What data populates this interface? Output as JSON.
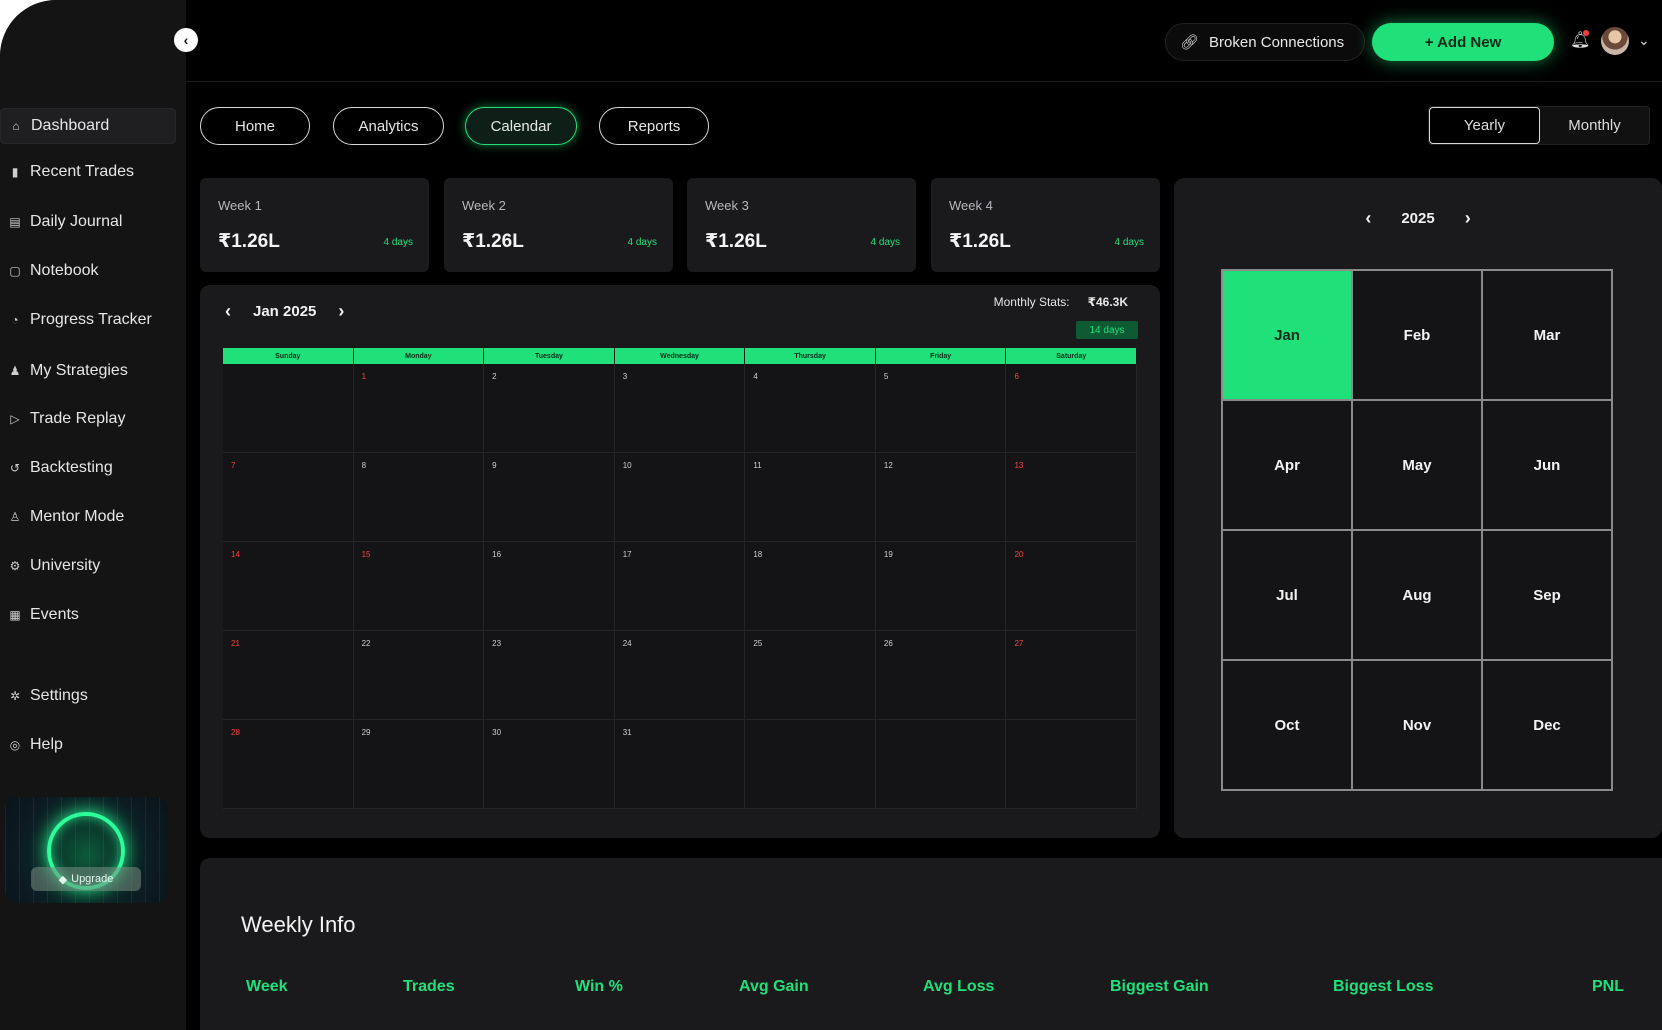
{
  "sidebar": {
    "items": [
      {
        "label": "Dashboard",
        "icon": "home-icon",
        "glyph": "⌂"
      },
      {
        "label": "Recent Trades",
        "icon": "bar-chart-icon",
        "glyph": "▮"
      },
      {
        "label": "Daily Journal",
        "icon": "journal-icon",
        "glyph": "▤"
      },
      {
        "label": "Notebook",
        "icon": "notebook-icon",
        "glyph": "▢"
      },
      {
        "label": "Progress Tracker",
        "icon": "progress-icon",
        "glyph": "◔"
      },
      {
        "label": "My Strategies",
        "icon": "strategy-icon",
        "glyph": "♟"
      },
      {
        "label": "Trade Replay",
        "icon": "play-icon",
        "glyph": "▷"
      },
      {
        "label": "Backtesting",
        "icon": "backtest-icon",
        "glyph": "↺"
      },
      {
        "label": "Mentor Mode",
        "icon": "mentor-icon",
        "glyph": "♙"
      },
      {
        "label": "University",
        "icon": "university-icon",
        "glyph": "⚙"
      },
      {
        "label": "Events",
        "icon": "events-icon",
        "glyph": "▦"
      },
      {
        "label": "Settings",
        "icon": "settings-icon",
        "glyph": "✲"
      },
      {
        "label": "Help",
        "icon": "help-icon",
        "glyph": "◎"
      }
    ],
    "promo": {
      "upgrade_label": "Upgrade"
    }
  },
  "topbar": {
    "broken_connections": "Broken Connections",
    "add_new": "+ Add New"
  },
  "tabs": [
    "Home",
    "Analytics",
    "Calendar",
    "Reports"
  ],
  "view_toggle": {
    "yearly": "Yearly",
    "monthly": "Monthly"
  },
  "weeks": [
    {
      "label": "Week 1",
      "amount": "₹1.26L",
      "days": "4 days"
    },
    {
      "label": "Week 2",
      "amount": "₹1.26L",
      "days": "4 days"
    },
    {
      "label": "Week 3",
      "amount": "₹1.26L",
      "days": "4 days"
    },
    {
      "label": "Week 4",
      "amount": "₹1.26L",
      "days": "4 days"
    }
  ],
  "calendar": {
    "month_label": "Jan 2025",
    "monthly_stats_label": "Monthly Stats:",
    "monthly_stats_value": "₹46.3K",
    "monthly_days": "14 days",
    "day_headers": [
      "Sunday",
      "Monday",
      "Tuesday",
      "Wednesday",
      "Thursday",
      "Friday",
      "Saturday"
    ],
    "weeks": [
      [
        "",
        "1",
        "2",
        "3",
        "4",
        "5",
        "6"
      ],
      [
        "7",
        "8",
        "9",
        "10",
        "11",
        "12",
        "13"
      ],
      [
        "14",
        "15",
        "16",
        "17",
        "18",
        "19",
        "20"
      ],
      [
        "21",
        "22",
        "23",
        "24",
        "25",
        "26",
        "27"
      ],
      [
        "28",
        "29",
        "30",
        "31",
        "",
        "",
        ""
      ]
    ],
    "red_days": [
      "1",
      "6",
      "7",
      "13",
      "14",
      "15",
      "20",
      "21",
      "27",
      "28"
    ]
  },
  "year_view": {
    "year": "2025",
    "months": [
      "Jan",
      "Feb",
      "Mar",
      "Apr",
      "May",
      "Jun",
      "Jul",
      "Aug",
      "Sep",
      "Oct",
      "Nov",
      "Dec"
    ],
    "selected": "Jan"
  },
  "weekly_info": {
    "title": "Weekly Info",
    "columns": [
      "Week",
      "Trades",
      "Win %",
      "Avg Gain",
      "Avg Loss",
      "Biggest Gain",
      "Biggest Loss",
      "PNL"
    ]
  },
  "colors": {
    "accent": "#20e07a",
    "negative": "#ff4040",
    "panel": "#1a1a1c"
  }
}
